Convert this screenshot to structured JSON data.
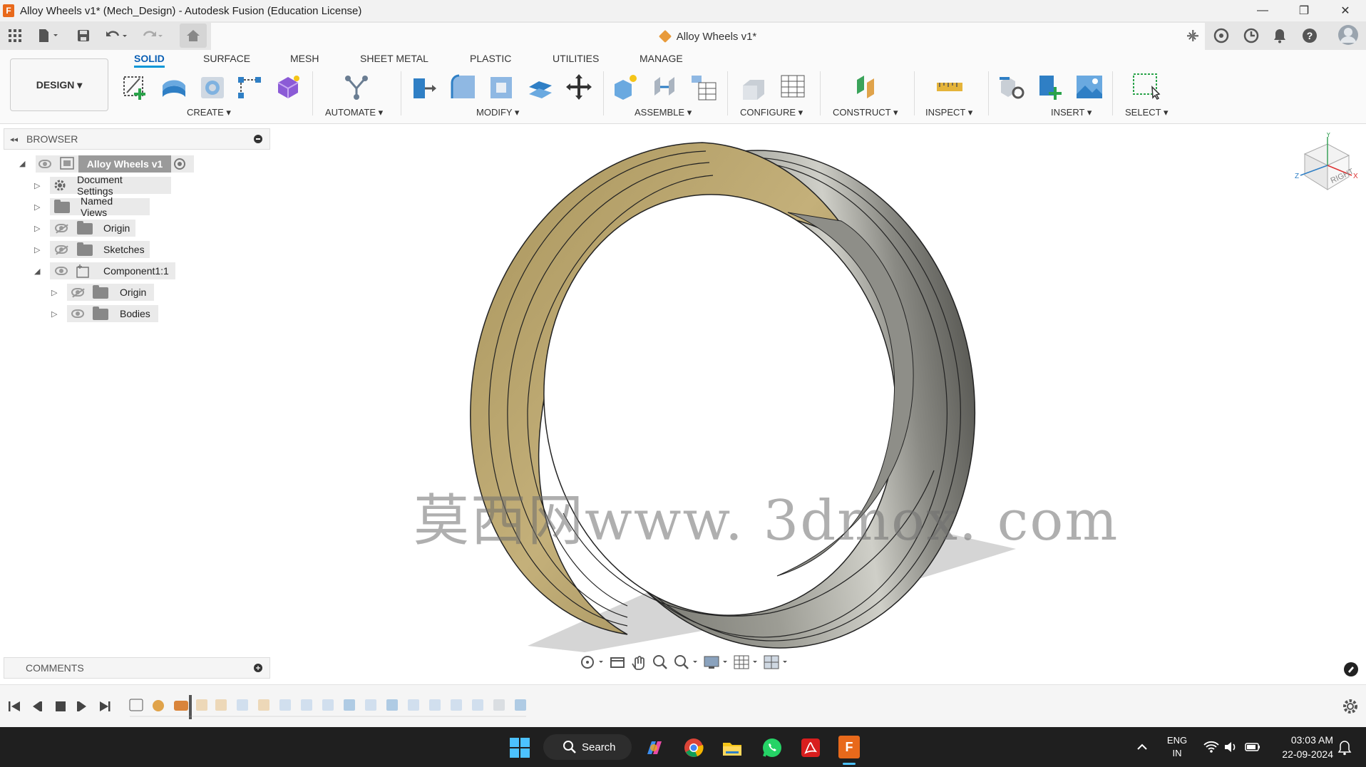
{
  "window": {
    "title": "Alloy Wheels v1* (Mech_Design) - Autodesk Fusion (Education License)",
    "app_icon_letter": "F",
    "controls": [
      "—",
      "❐",
      "✕"
    ]
  },
  "document_tab": {
    "name": "Alloy Wheels v1*",
    "close": "✕"
  },
  "ribbon": {
    "workspace_button": "DESIGN ▾",
    "tabs": [
      "SOLID",
      "SURFACE",
      "MESH",
      "SHEET METAL",
      "PLASTIC",
      "UTILITIES",
      "MANAGE"
    ],
    "active_tab": "SOLID",
    "groups": [
      "CREATE ▾",
      "AUTOMATE ▾",
      "MODIFY ▾",
      "ASSEMBLE ▾",
      "CONFIGURE ▾",
      "CONSTRUCT ▾",
      "INSPECT ▾",
      "INSERT ▾",
      "SELECT ▾"
    ]
  },
  "browser": {
    "header": "BROWSER",
    "root": "Alloy Wheels v1",
    "items": [
      {
        "label": "Document Settings"
      },
      {
        "label": "Named Views"
      },
      {
        "label": "Origin"
      },
      {
        "label": "Sketches"
      },
      {
        "label": "Component1:1"
      },
      {
        "label": "Origin"
      },
      {
        "label": "Bodies"
      }
    ]
  },
  "comments": {
    "header": "COMMENTS"
  },
  "viewcube": {
    "face": "RIGHT",
    "axis_x": "X",
    "axis_y": "Y",
    "axis_z": "Z"
  },
  "watermark": "莫西网www. 3dmox. com",
  "taskbar": {
    "search": "Search",
    "lang_top": "ENG",
    "lang_bottom": "IN",
    "time": "03:03 AM",
    "date": "22-09-2024"
  },
  "colors": {
    "accent": "#0696d7",
    "rim_gold": "#b9a46a",
    "rim_steel": "#8f8f88",
    "fusion_orange": "#e8691b"
  }
}
